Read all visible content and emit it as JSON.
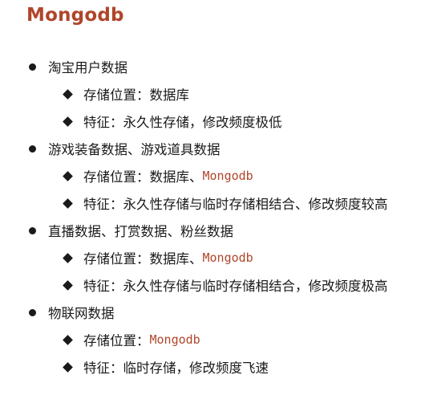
{
  "title": "Mongodb",
  "sections": [
    {
      "label": "淘宝用户数据",
      "items": [
        {
          "prefix": "存储位置：数据库",
          "code": ""
        },
        {
          "prefix": "特征：永久性存储，修改频度极低",
          "code": ""
        }
      ]
    },
    {
      "label": "游戏装备数据、游戏道具数据",
      "items": [
        {
          "prefix": "存储位置：数据库、",
          "code": "Mongodb"
        },
        {
          "prefix": "特征：永久性存储与临时存储相结合、修改频度较高",
          "code": ""
        }
      ]
    },
    {
      "label": "直播数据、打赏数据、粉丝数据",
      "items": [
        {
          "prefix": "存储位置：数据库、",
          "code": "Mongodb"
        },
        {
          "prefix": "特征：永久性存储与临时存储相结合，修改频度极高",
          "code": ""
        }
      ]
    },
    {
      "label": "物联网数据",
      "items": [
        {
          "prefix": "存储位置：",
          "code": "Mongodb"
        },
        {
          "prefix": "特征：临时存储，修改频度飞速",
          "code": ""
        }
      ]
    }
  ],
  "colors": {
    "accent": "#b0452a",
    "text": "#1a1a1a"
  },
  "icons": {
    "level1": "bullet-dot-icon",
    "level2": "bullet-diamond-icon"
  }
}
